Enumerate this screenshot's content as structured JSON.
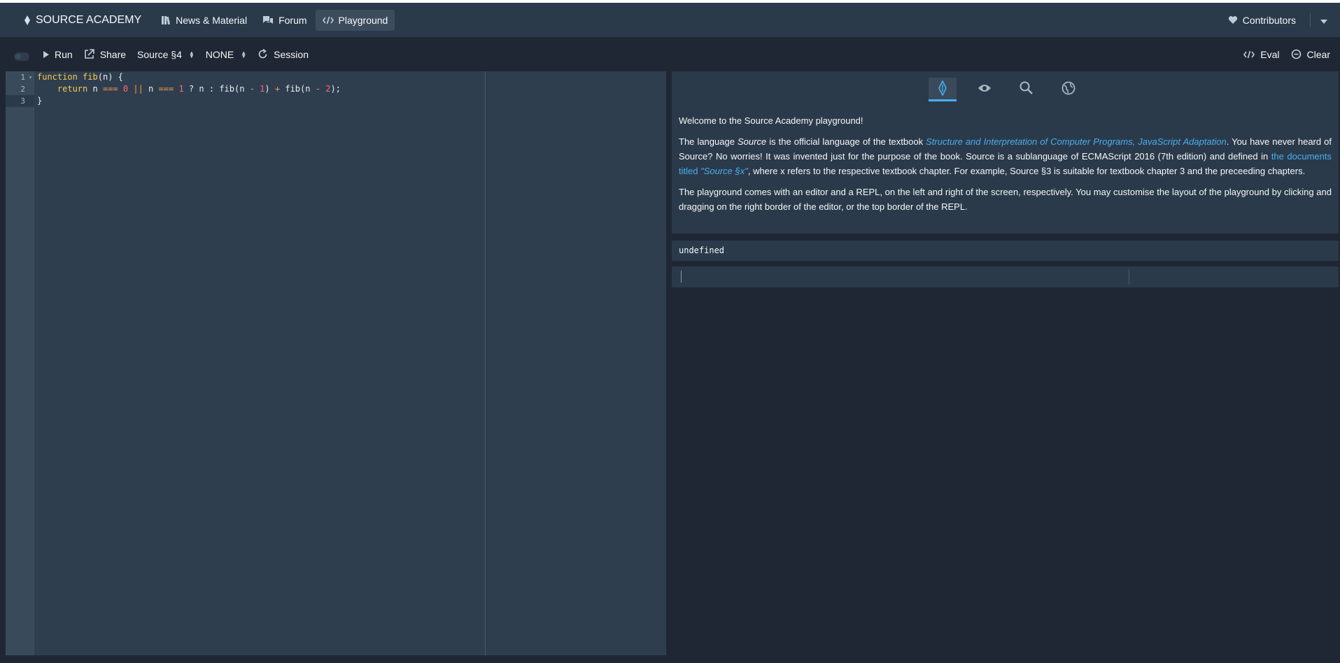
{
  "navbar": {
    "brand": "SOURCE ACADEMY",
    "items": [
      {
        "label": "News & Material",
        "icon": "book-icon"
      },
      {
        "label": "Forum",
        "icon": "chat-icon"
      },
      {
        "label": "Playground",
        "icon": "code-icon",
        "active": true
      }
    ],
    "contributors": "Contributors"
  },
  "toolbar": {
    "run": "Run",
    "share": "Share",
    "chapter": "Source §4",
    "variant": "NONE",
    "session": "Session",
    "eval": "Eval",
    "clear": "Clear"
  },
  "editor": {
    "line_numbers": [
      "1",
      "2",
      "3"
    ],
    "code": "function fib(n) {\n    return n === 0 || n === 1 ? n : fib(n - 1) + fib(n - 2);\n}"
  },
  "panel": {
    "tabs": [
      "introduction-icon",
      "eye-icon",
      "search-icon",
      "globe-icon"
    ],
    "welcome": "Welcome to the Source Academy playground!",
    "p1_a": "The language ",
    "p1_source": "Source",
    "p1_b": " is the official language of the textbook ",
    "p1_book": "Structure and Interpretation of Computer Programs, JavaScript Adaptation",
    "p1_c": ". You have never heard of Source? No worries! It was invented just for the purpose of the book. Source is a sublanguage of ECMAScript 2016 (7th edition) and defined in ",
    "p1_docs": "the documents titled ",
    "p1_docs_italic": "\"Source §x\"",
    "p1_d": ", where x refers to the respective textbook chapter. For example, Source §3 is suitable for textbook chapter 3 and the preceeding chapters.",
    "p2": "The playground comes with an editor and a REPL, on the left and right of the screen, respectively. You may customise the layout of the playground by clicking and dragging on the right border of the editor, or the top border of the REPL.",
    "output": "undefined"
  },
  "colors": {
    "accent": "#48aff0",
    "navbar_bg": "#2b3a4a",
    "page_bg": "#1e2733",
    "editor_bg": "#2f3e4f",
    "keyword": "#f6c94e",
    "number": "#ff6b72",
    "operator": "#ff9a42"
  }
}
